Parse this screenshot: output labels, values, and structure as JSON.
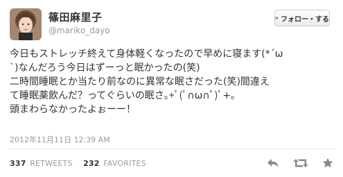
{
  "user": {
    "display_name": "篠田麻里子",
    "handle": "@mariko_dayo"
  },
  "follow_button": {
    "label": "フォロー・する",
    "icon": "bird-icon"
  },
  "tweet": {
    "lines": [
      "今日もストレッチ終えて身体軽くなったので早めに寝ます(*´ω",
      "`)なんだろう今日はずーっと眠かったの(笑)",
      "二時間睡眠とか当たり前なのに異常な眠さだった(笑)間違え",
      "て睡眠薬飲んだ？ってぐらいの眠さ｡+ﾟ(ﾟ∩ω∩ﾟ)ﾟ+｡",
      "頭まわらなかったよぉーー！"
    ]
  },
  "timestamp": "2012年11月11日  12:39 AM",
  "stats": {
    "retweets_count": "337",
    "retweets_label": "RETWEETS",
    "favorites_count": "232",
    "favorites_label": "FAVORITES"
  },
  "actions": [
    "reply-icon",
    "retweet-icon",
    "favorite-icon"
  ],
  "colors": {
    "text": "#333333",
    "muted": "#999999",
    "bird": "#3ea2e0",
    "icon": "#8a8a8a"
  }
}
